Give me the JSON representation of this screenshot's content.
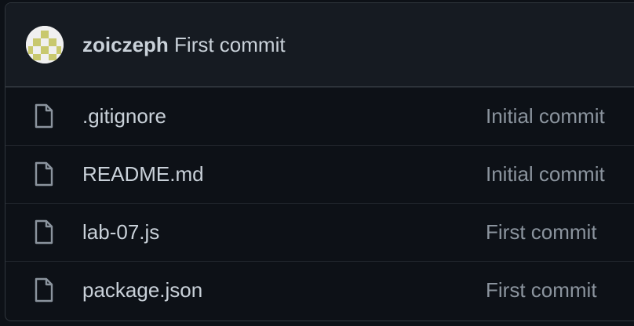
{
  "latest_commit": {
    "author": "zoiczeph",
    "message": "First commit"
  },
  "files": [
    {
      "name": ".gitignore",
      "commit": "Initial commit",
      "icon": "file-icon"
    },
    {
      "name": "README.md",
      "commit": "Initial commit",
      "icon": "file-icon"
    },
    {
      "name": "lab-07.js",
      "commit": "First commit",
      "icon": "file-icon"
    },
    {
      "name": "package.json",
      "commit": "First commit",
      "icon": "file-icon"
    }
  ],
  "colors": {
    "background": "#0d1117",
    "header_background": "#161b22",
    "border": "#30363d",
    "text": "#c9d1d9",
    "muted_text": "#8b949e",
    "avatar_pattern": "#c8c86e"
  }
}
